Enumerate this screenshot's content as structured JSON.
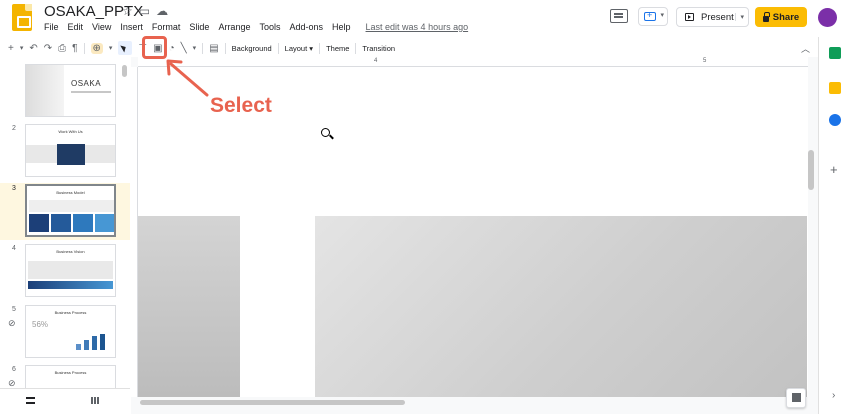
{
  "header": {
    "title": "OSAKA_PPTX",
    "menus": [
      "File",
      "Edit",
      "View",
      "Insert",
      "Format",
      "Slide",
      "Arrange",
      "Tools",
      "Add-ons",
      "Help"
    ],
    "last_edit": "Last edit was 4 hours ago",
    "present_label": "Present",
    "share_label": "Share"
  },
  "toolbar": {
    "background_label": "Background",
    "layout_label": "Layout",
    "theme_label": "Theme",
    "transition_label": "Transition"
  },
  "ruler": {
    "marks": [
      "4",
      "5"
    ]
  },
  "filmstrip": {
    "slides": [
      {
        "num": "",
        "title": "OSAKA"
      },
      {
        "num": "2",
        "title": "Work With Us"
      },
      {
        "num": "3",
        "title": "Business Model"
      },
      {
        "num": "4",
        "title": "Business Vision"
      },
      {
        "num": "5",
        "title": "Business Process",
        "stat": "56%"
      },
      {
        "num": "6",
        "title": "Business Process"
      }
    ],
    "selected": 3
  },
  "annotation": {
    "label": "Select",
    "color": "#e8634f"
  },
  "colors": {
    "accent": "#fbbc04",
    "avatar": "#7b2fa8",
    "blue": "#1a73e8"
  }
}
